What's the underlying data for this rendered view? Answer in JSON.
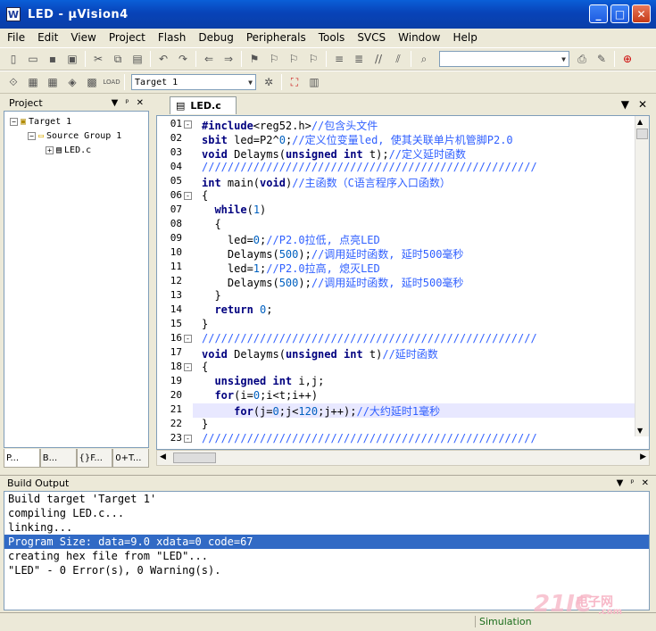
{
  "window": {
    "title": "LED  - µVision4",
    "icon": "uvision-app-icon"
  },
  "menu": [
    "File",
    "Edit",
    "View",
    "Project",
    "Flash",
    "Debug",
    "Peripherals",
    "Tools",
    "SVCS",
    "Window",
    "Help"
  ],
  "toolbar": {
    "target_select": "Target 1"
  },
  "project": {
    "title": "Project",
    "tree": {
      "target": "Target 1",
      "group": "Source Group 1",
      "file": "LED.c"
    },
    "tabs": [
      "P...",
      "B...",
      "{}F...",
      "0+T..."
    ]
  },
  "editor": {
    "tab": "LED.c",
    "lines": [
      {
        "n": "01",
        "fold": "-"
      },
      {
        "n": "02"
      },
      {
        "n": "03"
      },
      {
        "n": "04"
      },
      {
        "n": "05"
      },
      {
        "n": "06",
        "fold": "-"
      },
      {
        "n": "07"
      },
      {
        "n": "08"
      },
      {
        "n": "09"
      },
      {
        "n": "10"
      },
      {
        "n": "11"
      },
      {
        "n": "12"
      },
      {
        "n": "13"
      },
      {
        "n": "14"
      },
      {
        "n": "15"
      },
      {
        "n": "16",
        "fold": "-"
      },
      {
        "n": "17"
      },
      {
        "n": "18",
        "fold": "-"
      },
      {
        "n": "19"
      },
      {
        "n": "20"
      },
      {
        "n": "21"
      },
      {
        "n": "22"
      },
      {
        "n": "23",
        "fold": "-"
      }
    ],
    "code": [
      "#include<reg52.h>//包含头文件",
      "sbit led=P2^0;//定义位变量led, 使其关联单片机管脚P2.0",
      "void Delayms(unsigned int t);//定义延时函数",
      "////////////////////////////////////////////////////",
      "int main(void)//主函数（C语言程序入口函数）",
      "{",
      "  while(1)",
      "  {",
      "    led=0;//P2.0拉低, 点亮LED",
      "    Delayms(500);//调用延时函数, 延时500毫秒",
      "    led=1;//P2.0拉高, 熄灭LED",
      "    Delayms(500);//调用延时函数, 延时500毫秒",
      "  }",
      "  return 0;",
      "}",
      "////////////////////////////////////////////////////",
      "void Delayms(unsigned int t)//延时函数",
      "{",
      "  unsigned int i,j;",
      "  for(i=0;i<t;i++)",
      "     for(j=0;j<120;j++);//大约延时1毫秒",
      "}",
      "////////////////////////////////////////////////////"
    ]
  },
  "build_output": {
    "title": "Build Output",
    "lines": [
      "Build target 'Target 1'",
      "compiling LED.c...",
      "linking...",
      "Program Size: data=9.0 xdata=0 code=67",
      "creating hex file from \"LED\"...",
      "\"LED\" - 0 Error(s), 0 Warning(s)."
    ]
  },
  "status": {
    "mode": "Simulation"
  },
  "watermark": {
    "text": "21IC",
    "cn": "电子网",
    "domain": ".com"
  }
}
